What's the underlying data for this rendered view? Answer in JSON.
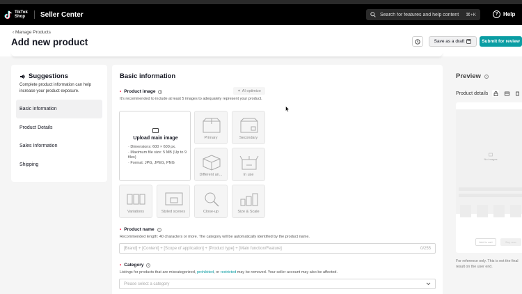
{
  "topbar": {
    "logo_text": "TikTok Shop",
    "app_name": "Seller Center",
    "search_placeholder": "Search for features and help content",
    "search_shortcut": "⌘+K",
    "help_label": "Help"
  },
  "header": {
    "breadcrumb": "‹ Manage Products",
    "title": "Add new product",
    "save_draft_label": "Save as a draft",
    "submit_label": "Submit for review"
  },
  "suggestions": {
    "title": "Suggestions",
    "description": "Complete product information can help increase your product exposure.",
    "items": [
      {
        "label": "Basic information",
        "active": true
      },
      {
        "label": "Product Details",
        "active": false
      },
      {
        "label": "Sales Information",
        "active": false
      },
      {
        "label": "Shipping",
        "active": false
      }
    ]
  },
  "basic_info": {
    "title": "Basic information",
    "product_image": {
      "label": "Product image",
      "ai_button": "AI optimize",
      "hint": "It's recommended to include at least 5 images to adequately represent your product.",
      "upload_title": "Upload main image",
      "upload_details": [
        "· Dimensions: 600 × 600 px.",
        "· Maximum file size: 5 MB (Up to 9 files)",
        "· Format: JPG, JPEG, PNG"
      ],
      "slots": [
        "Primary",
        "Secondary",
        "Different an...",
        "In use",
        "Variations",
        "Styled scenes",
        "Close-up",
        "Size & Scale"
      ]
    },
    "product_name": {
      "label": "Product name",
      "hint": "Recommended length: 40 characters or more. The category will be automatically identified by the product name.",
      "placeholder": "[Brand] + [Content] + [Scope of application] + [Product type] + [Main function/Feature]",
      "counter": "0/255"
    },
    "category": {
      "label": "Category",
      "hint_prefix": "Listings for products that are miscategorized, ",
      "hint_link1": "prohibited",
      "hint_mid": ", or ",
      "hint_link2": "restricted",
      "hint_suffix": " may be removed. Your seller account may also be affected.",
      "placeholder": "Please select a category"
    }
  },
  "preview": {
    "title": "Preview",
    "tab_label": "Product details",
    "no_images": "No images",
    "add_to_cart": "Add to cart",
    "buy_now": "Buy now",
    "note": "For reference only. This is not the final result on the user end."
  },
  "colors": {
    "accent": "#0a9da3",
    "required": "#fe2c55",
    "topbar": "#000000"
  }
}
